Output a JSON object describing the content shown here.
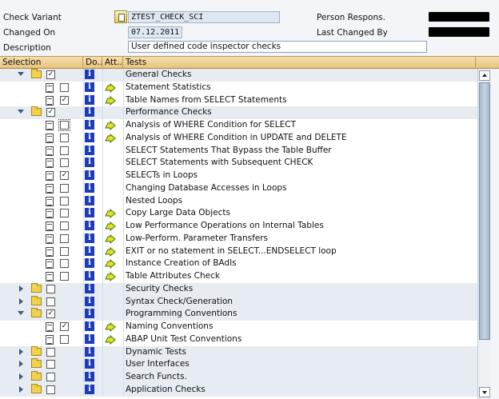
{
  "header": {
    "check_variant_label": "Check Variant",
    "check_variant_value": "ZTEST_CHECK_SCI",
    "changed_on_label": "Changed On",
    "changed_on_value": "07.12.2011",
    "description_label": "Description",
    "description_value": "User defined code inspector checks",
    "person_label": "Person Respons.",
    "last_changed_label": "Last Changed By"
  },
  "columns": {
    "selection": "Selection",
    "doc": "Do...",
    "attr": "Att...",
    "tests": "Tests"
  },
  "rows": [
    {
      "kind": "group",
      "expand": "down",
      "checked": true,
      "label": "General Checks"
    },
    {
      "kind": "item",
      "checked": false,
      "exec": true,
      "label": "Statement Statistics"
    },
    {
      "kind": "item",
      "checked": true,
      "exec": true,
      "label": "Table Names from SELECT Statements"
    },
    {
      "kind": "group",
      "expand": "down",
      "checked": true,
      "open": true,
      "label": "Performance Checks"
    },
    {
      "kind": "item",
      "checked": false,
      "focus": true,
      "exec": true,
      "label": "Analysis of WHERE Condition for SELECT"
    },
    {
      "kind": "item",
      "checked": false,
      "exec": true,
      "label": "Analysis of WHERE Condition in UPDATE and DELETE"
    },
    {
      "kind": "item",
      "checked": false,
      "exec": false,
      "label": "SELECT Statements That Bypass the Table Buffer"
    },
    {
      "kind": "item",
      "checked": false,
      "exec": false,
      "label": "SELECT Statements with Subsequent CHECK"
    },
    {
      "kind": "item",
      "checked": true,
      "exec": false,
      "label": "SELECTs in Loops"
    },
    {
      "kind": "item",
      "checked": false,
      "exec": false,
      "label": "Changing Database Accesses in Loops"
    },
    {
      "kind": "item",
      "checked": false,
      "exec": false,
      "label": "Nested Loops"
    },
    {
      "kind": "item",
      "checked": false,
      "exec": true,
      "label": "Copy Large Data Objects"
    },
    {
      "kind": "item",
      "checked": false,
      "exec": true,
      "label": "Low Performance Operations on Internal Tables"
    },
    {
      "kind": "item",
      "checked": false,
      "exec": true,
      "label": "Low-Perform. Parameter Transfers"
    },
    {
      "kind": "item",
      "checked": false,
      "exec": true,
      "label": "EXIT or no statement in SELECT...ENDSELECT loop"
    },
    {
      "kind": "item",
      "checked": false,
      "exec": true,
      "label": "Instance Creation of BAdIs"
    },
    {
      "kind": "item",
      "checked": false,
      "exec": true,
      "label": "Table Attributes Check"
    },
    {
      "kind": "group",
      "expand": "right",
      "checked": false,
      "label": "Security Checks"
    },
    {
      "kind": "group",
      "expand": "right",
      "checked": false,
      "label": "Syntax Check/Generation"
    },
    {
      "kind": "group",
      "expand": "down",
      "checked": true,
      "label": "Programming Conventions"
    },
    {
      "kind": "item",
      "checked": true,
      "exec": true,
      "label": "Naming Conventions"
    },
    {
      "kind": "item",
      "checked": false,
      "exec": true,
      "label": "ABAP Unit Test Conventions"
    },
    {
      "kind": "group",
      "expand": "right",
      "checked": false,
      "label": "Dynamic Tests"
    },
    {
      "kind": "group",
      "expand": "right",
      "checked": false,
      "label": "User Interfaces"
    },
    {
      "kind": "group",
      "expand": "right",
      "checked": false,
      "label": "Search Functs."
    },
    {
      "kind": "group",
      "expand": "right",
      "checked": false,
      "label": "Application Checks"
    }
  ],
  "scrollbar": {
    "position_fraction": 0.0,
    "visible_fraction": 0.85
  },
  "colors": {
    "header_row": "#e8c47c",
    "group_row": "#e6ecf2",
    "info_icon": "#1c3cba",
    "folder": "#f2d24a"
  },
  "icons": {
    "info": "info-icon",
    "exec": "execute-arrow-icon",
    "doc": "document-icon",
    "folder": "folder-icon",
    "expand": "expand-triangle-icon"
  }
}
